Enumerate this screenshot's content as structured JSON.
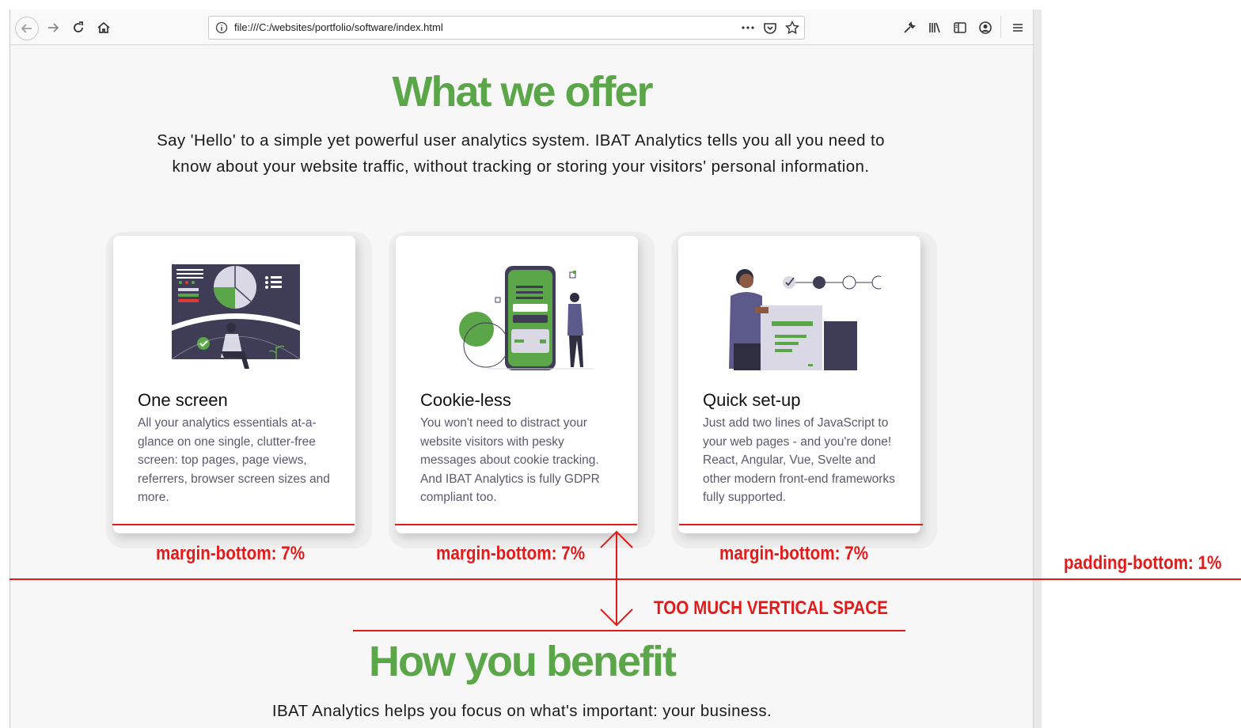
{
  "browser": {
    "url": "file:///C:/websites/portfolio/software/index.html",
    "icons": [
      "back-icon",
      "forward-icon",
      "reload-icon",
      "home-icon",
      "info-icon",
      "more-icon",
      "pocket-icon",
      "bookmark-star-icon",
      "wrench-icon",
      "library-icon",
      "sidebar-icon",
      "account-icon",
      "menu-icon"
    ]
  },
  "page": {
    "title": "What we offer",
    "intro": "Say 'Hello' to a simple yet powerful user analytics system. IBAT Analytics tells you all you need to know about your website traffic, without tracking or storing your visitors' personal information.",
    "cards": [
      {
        "title": "One screen",
        "text": "All your analytics essentials at-a-glance on one single, clutter-free screen: top pages, page views, referrers, browser screen sizes and more."
      },
      {
        "title": "Cookie-less",
        "text": "You won't need to distract your website visitors with pesky messages about cookie tracking. And IBAT Analytics is fully GDPR compliant too."
      },
      {
        "title": "Quick set-up",
        "text": "Just add two lines of JavaScript to your web pages - and you're done! React, Angular, Vue, Svelte and other modern front-end frameworks fully supported."
      }
    ],
    "benefit_title": "How you benefit",
    "benefit_intro": "IBAT Analytics helps you focus on what's important: your business."
  },
  "annotations": {
    "margin_bottom": "margin-bottom: 7%",
    "padding_bottom": "padding-bottom: 1%",
    "too_much_space": "TOO MUCH VERTICAL SPACE"
  },
  "colors": {
    "brand_green": "#5aa648",
    "annotation_red": "#e31a1a",
    "illustration_dark": "#3f3d56"
  }
}
